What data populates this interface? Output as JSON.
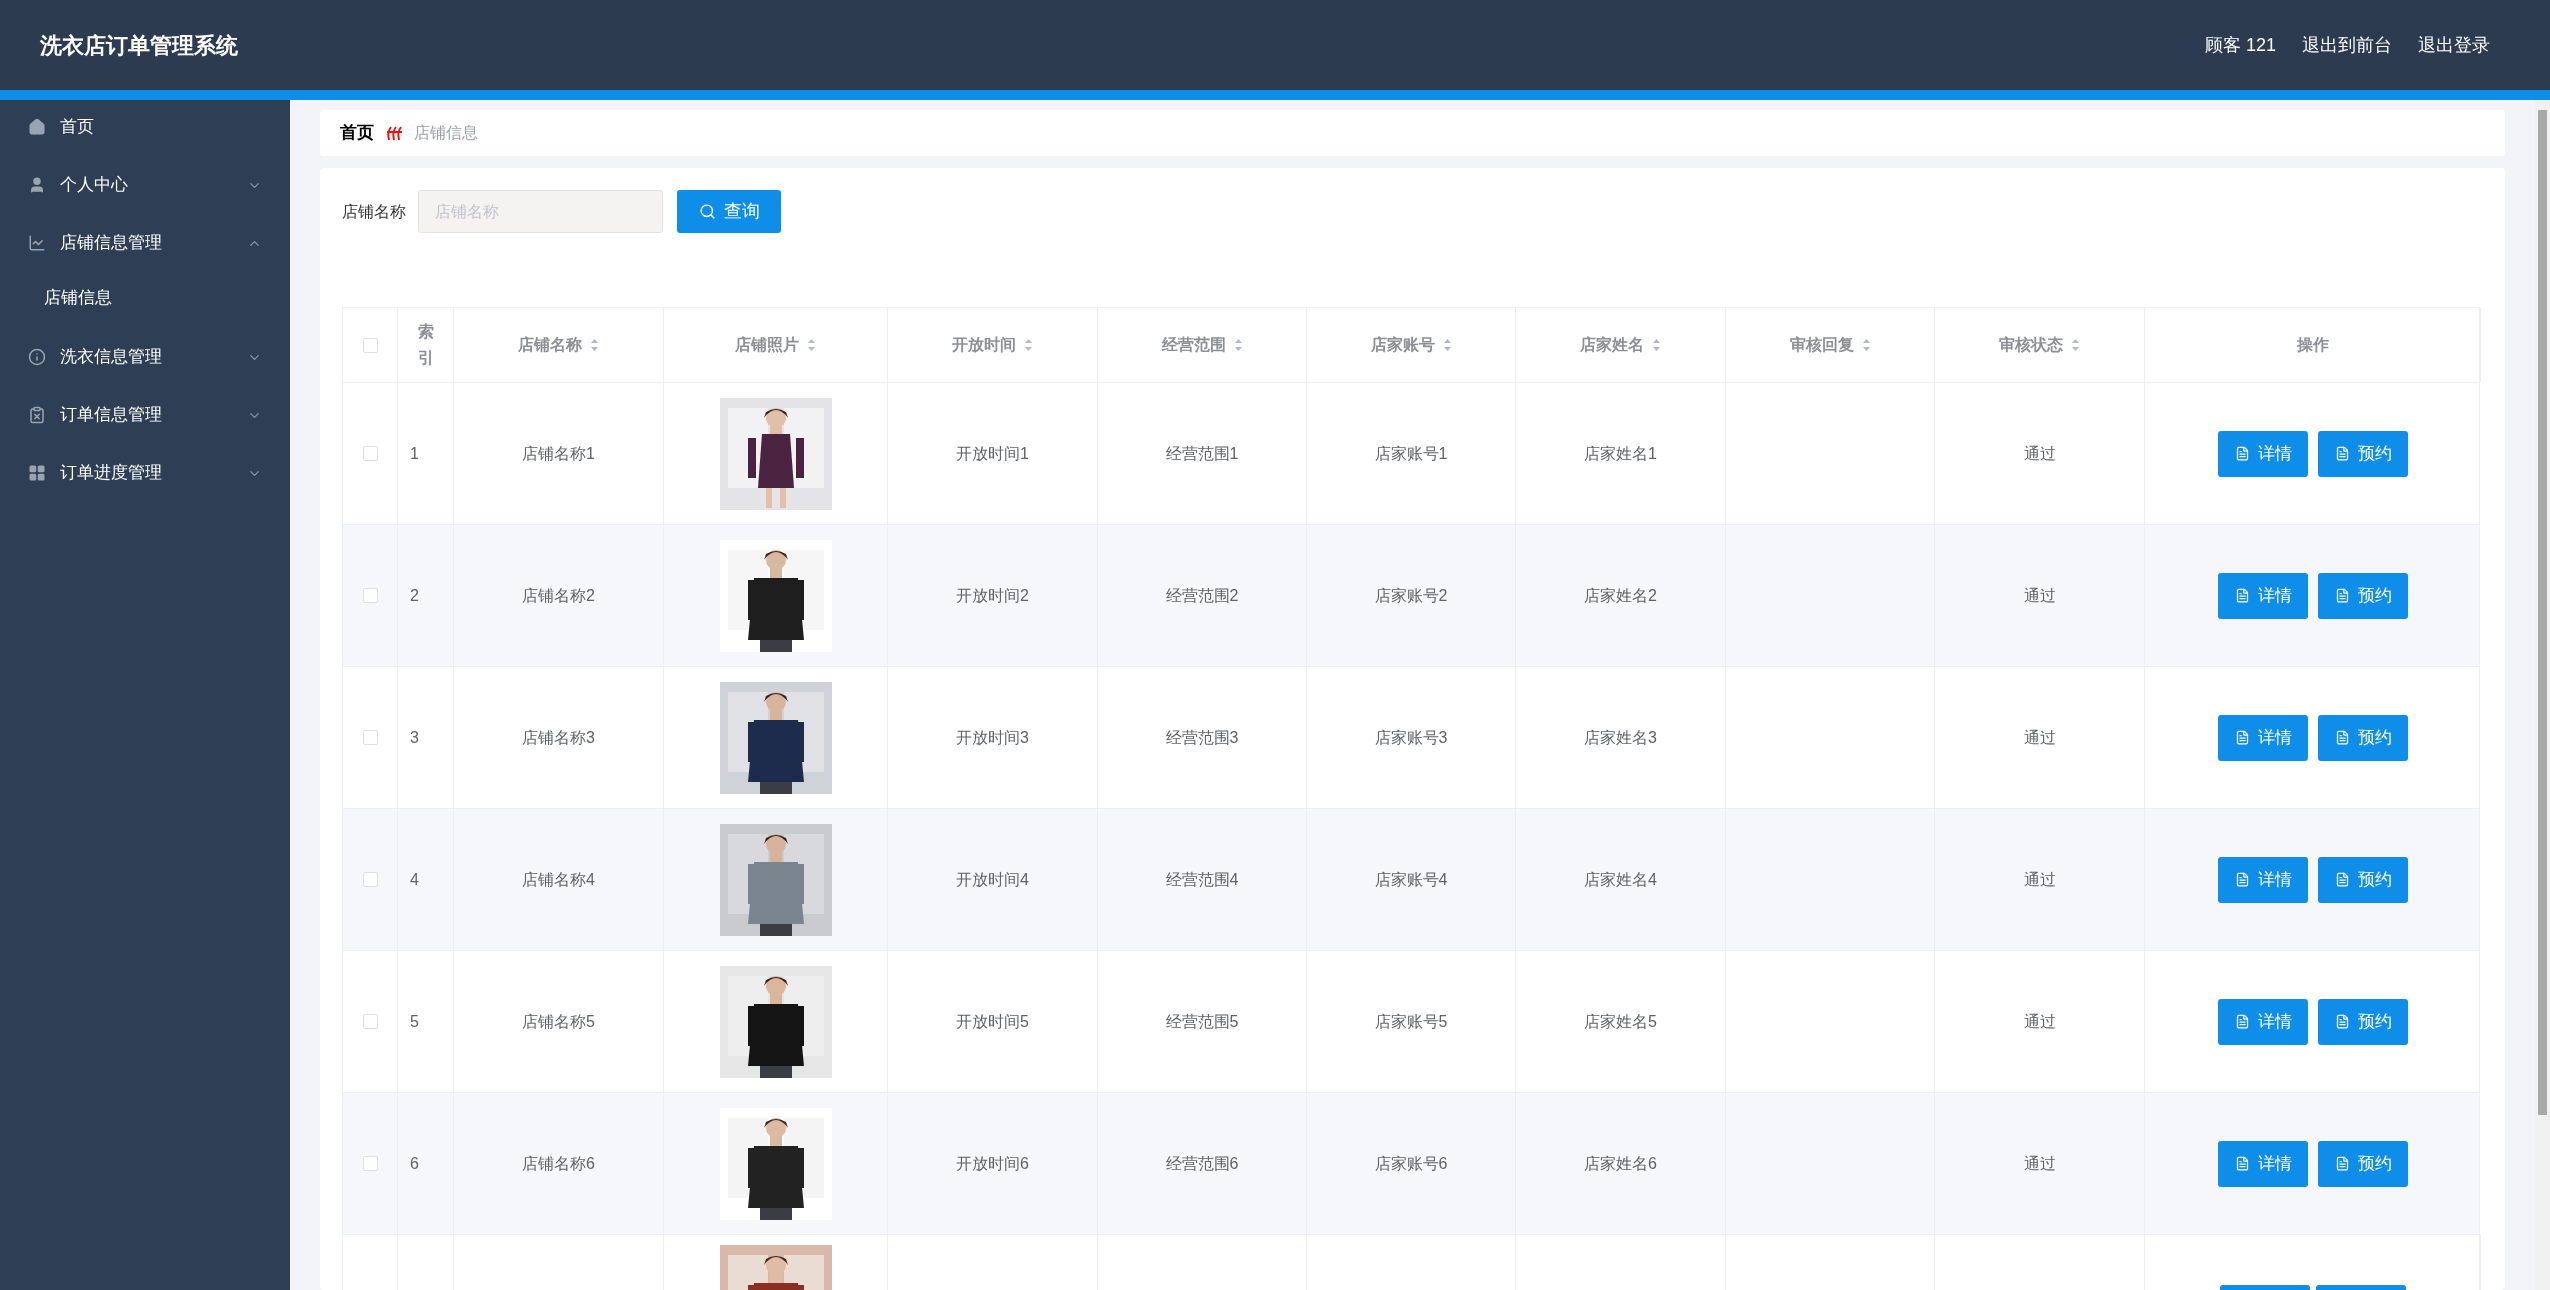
{
  "header": {
    "title": "洗衣店订单管理系统",
    "user": "顾客 121",
    "links": [
      "退出到前台",
      "退出登录"
    ]
  },
  "sidebar": {
    "items": [
      {
        "kind": "link",
        "label": "首页"
      },
      {
        "kind": "menu",
        "label": "个人中心",
        "expanded": false
      },
      {
        "kind": "menu",
        "label": "店铺信息管理",
        "expanded": true,
        "children": [
          {
            "label": "店铺信息"
          }
        ]
      },
      {
        "kind": "menu",
        "label": "洗衣信息管理",
        "expanded": false
      },
      {
        "kind": "menu",
        "label": "订单信息管理",
        "expanded": false
      },
      {
        "kind": "menu",
        "label": "订单进度管理",
        "expanded": false
      }
    ]
  },
  "breadcrumb": [
    "首页",
    "店铺信息"
  ],
  "search": {
    "label": "店铺名称",
    "placeholder": "店铺名称",
    "button": "查询"
  },
  "table": {
    "select_all": {
      "checked": false
    },
    "columns": [
      {
        "label": "索引",
        "sortable": false
      },
      {
        "label": "店铺名称",
        "sortable": true
      },
      {
        "label": "店铺照片",
        "sortable": true
      },
      {
        "label": "开放时间",
        "sortable": true
      },
      {
        "label": "经营范围",
        "sortable": true
      },
      {
        "label": "店家账号",
        "sortable": true
      },
      {
        "label": "店家姓名",
        "sortable": true
      },
      {
        "label": "审核回复",
        "sortable": true
      },
      {
        "label": "审核状态",
        "sortable": true
      },
      {
        "label": "操作",
        "sortable": false
      }
    ],
    "rows": [
      {
        "checked": false,
        "cells": [
          "1",
          "店铺名称1",
          "开放时间1",
          "经营范围1",
          "店家账号1",
          "店家姓名1",
          "",
          "通过"
        ],
        "actions": [
          "详情",
          "预约"
        ]
      },
      {
        "checked": false,
        "cells": [
          "2",
          "店铺名称2",
          "开放时间2",
          "经营范围2",
          "店家账号2",
          "店家姓名2",
          "",
          "通过"
        ],
        "actions": [
          "详情",
          "预约"
        ]
      },
      {
        "checked": false,
        "cells": [
          "3",
          "店铺名称3",
          "开放时间3",
          "经营范围3",
          "店家账号3",
          "店家姓名3",
          "",
          "通过"
        ],
        "actions": [
          "详情",
          "预约"
        ]
      },
      {
        "checked": false,
        "cells": [
          "4",
          "店铺名称4",
          "开放时间4",
          "经营范围4",
          "店家账号4",
          "店家姓名4",
          "",
          "通过"
        ],
        "actions": [
          "详情",
          "预约"
        ]
      },
      {
        "checked": false,
        "cells": [
          "5",
          "店铺名称5",
          "开放时间5",
          "经营范围5",
          "店家账号5",
          "店家姓名5",
          "",
          "通过"
        ],
        "actions": [
          "详情",
          "预约"
        ]
      },
      {
        "checked": false,
        "cells": [
          "6",
          "店铺名称6",
          "开放时间6",
          "经营范围6",
          "店家账号6",
          "店家姓名6",
          "",
          "通过"
        ],
        "actions": [
          "详情",
          "预约"
        ]
      },
      {
        "kind": "cut"
      }
    ]
  }
}
